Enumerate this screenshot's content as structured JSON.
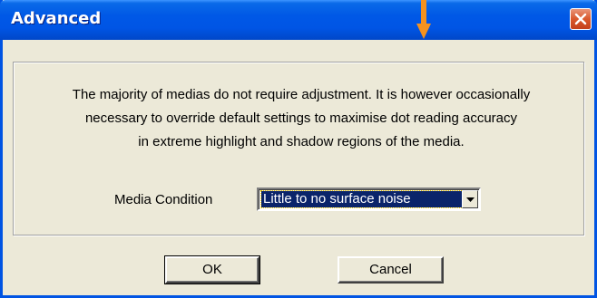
{
  "window": {
    "title": "Advanced"
  },
  "message": {
    "lines": [
      "The majority of medias do not require adjustment. It is however occasionally",
      "necessary to override default settings to maximise dot reading accuracy",
      "in extreme highlight and shadow regions of the media."
    ]
  },
  "media_condition": {
    "label": "Media Condition",
    "selected": "Little to no surface noise"
  },
  "buttons": {
    "ok_label": "OK",
    "cancel_label": "Cancel"
  },
  "colors": {
    "titlebar": "#0055e5",
    "close_button": "#d9582c",
    "dialog_face": "#ece9d8",
    "selection": "#0a246a",
    "annotation_arrow": "#f5921e"
  },
  "icons": {
    "close": "close-icon",
    "dropdown": "chevron-down-icon",
    "annotation": "arrow-down-icon"
  }
}
